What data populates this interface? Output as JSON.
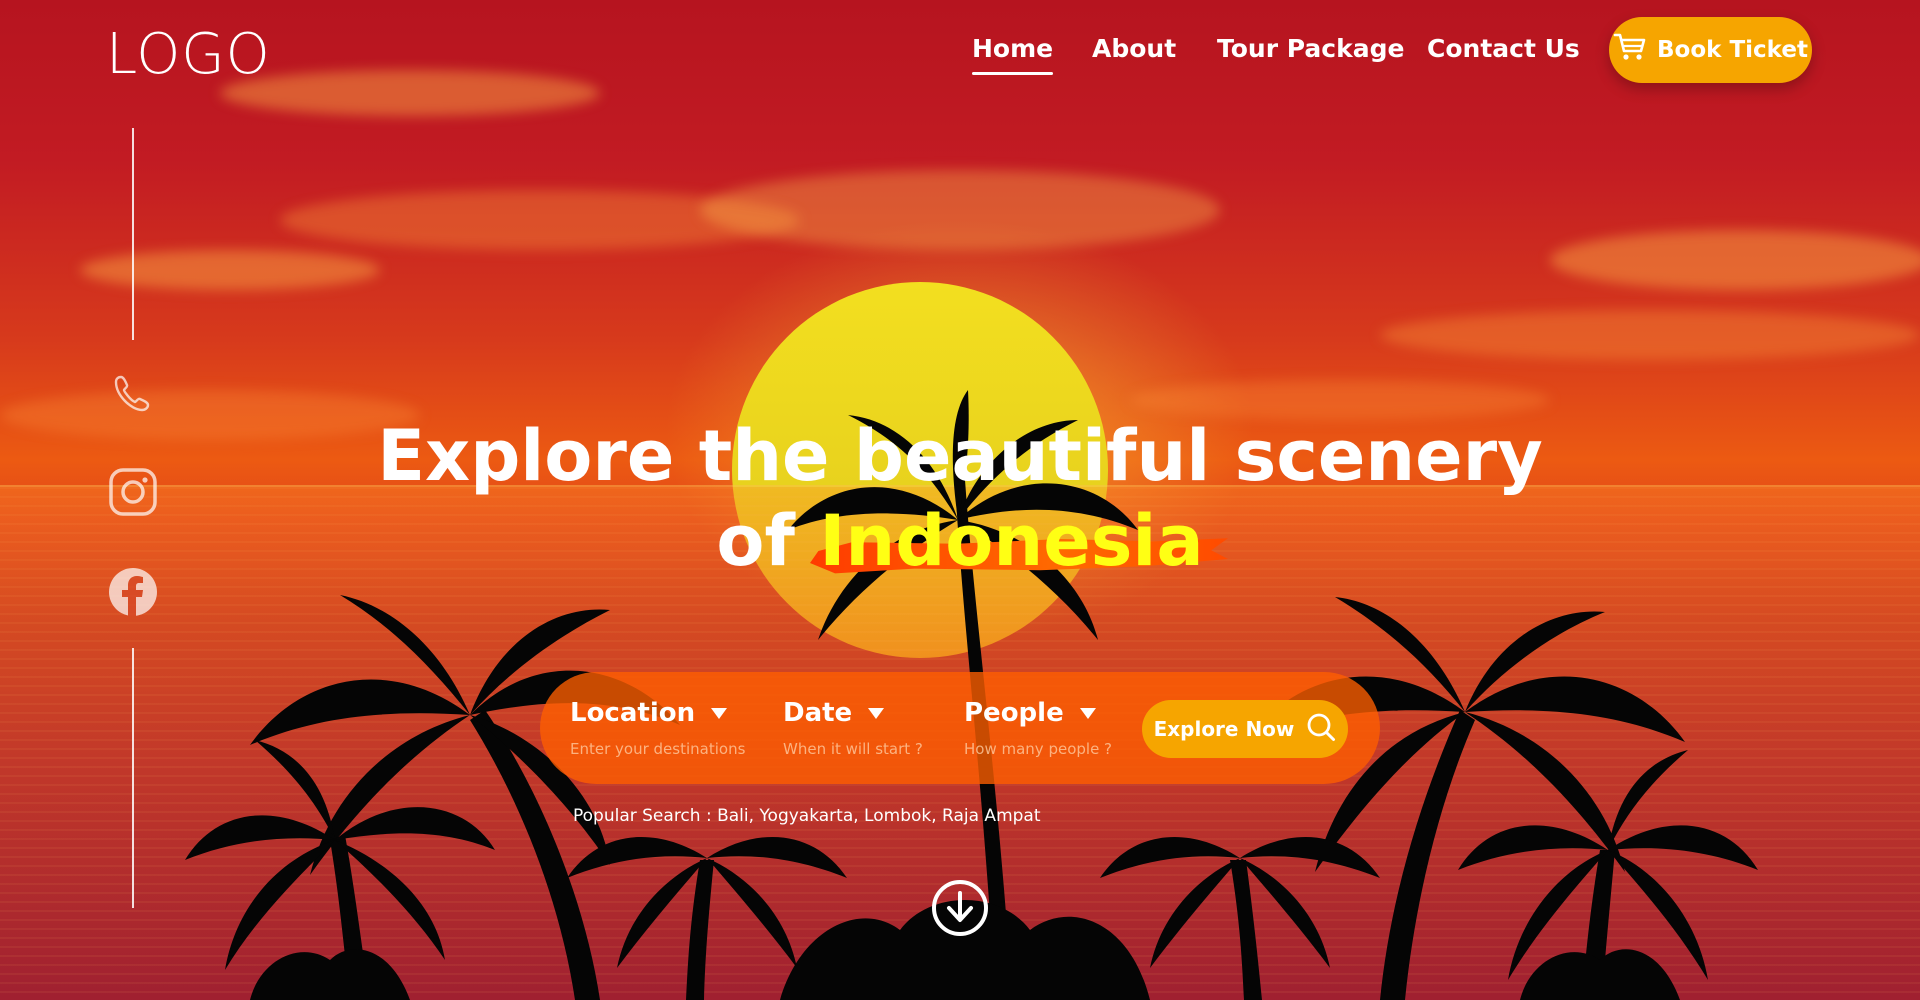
{
  "header": {
    "logo_text": "LOGO",
    "nav": [
      {
        "label": "Home",
        "active": true
      },
      {
        "label": "About",
        "active": false
      },
      {
        "label": "Tour Package",
        "active": false
      },
      {
        "label": "Contact Us",
        "active": false
      }
    ],
    "book_button": {
      "label": "Book Ticket",
      "icon": "cart-icon"
    }
  },
  "sidebar": {
    "socials": [
      {
        "name": "phone",
        "icon": "phone-icon"
      },
      {
        "name": "instagram",
        "icon": "instagram-icon"
      },
      {
        "name": "facebook",
        "icon": "facebook-icon"
      }
    ]
  },
  "hero": {
    "headline_line1": "Explore the beautiful scenery",
    "headline_line2_prefix": "of ",
    "headline_highlight": "Indonesia",
    "highlight_color": "#ffff14"
  },
  "search": {
    "fields": [
      {
        "label": "Location",
        "hint": "Enter your destinations"
      },
      {
        "label": "Date",
        "hint": "When it will start ?"
      },
      {
        "label": "People",
        "hint": "How many people ?"
      }
    ],
    "button": {
      "label": "Explore Now",
      "icon": "search-icon"
    },
    "popular_search": "Popular Search : Bali, Yogyakarta, Lombok, Raja Ampat"
  },
  "scroll_icon": "arrow-down-circle-icon",
  "colors": {
    "accent_button": "#f6a500",
    "search_bar": "#ff5f00",
    "highlight_text": "#ffff14"
  }
}
